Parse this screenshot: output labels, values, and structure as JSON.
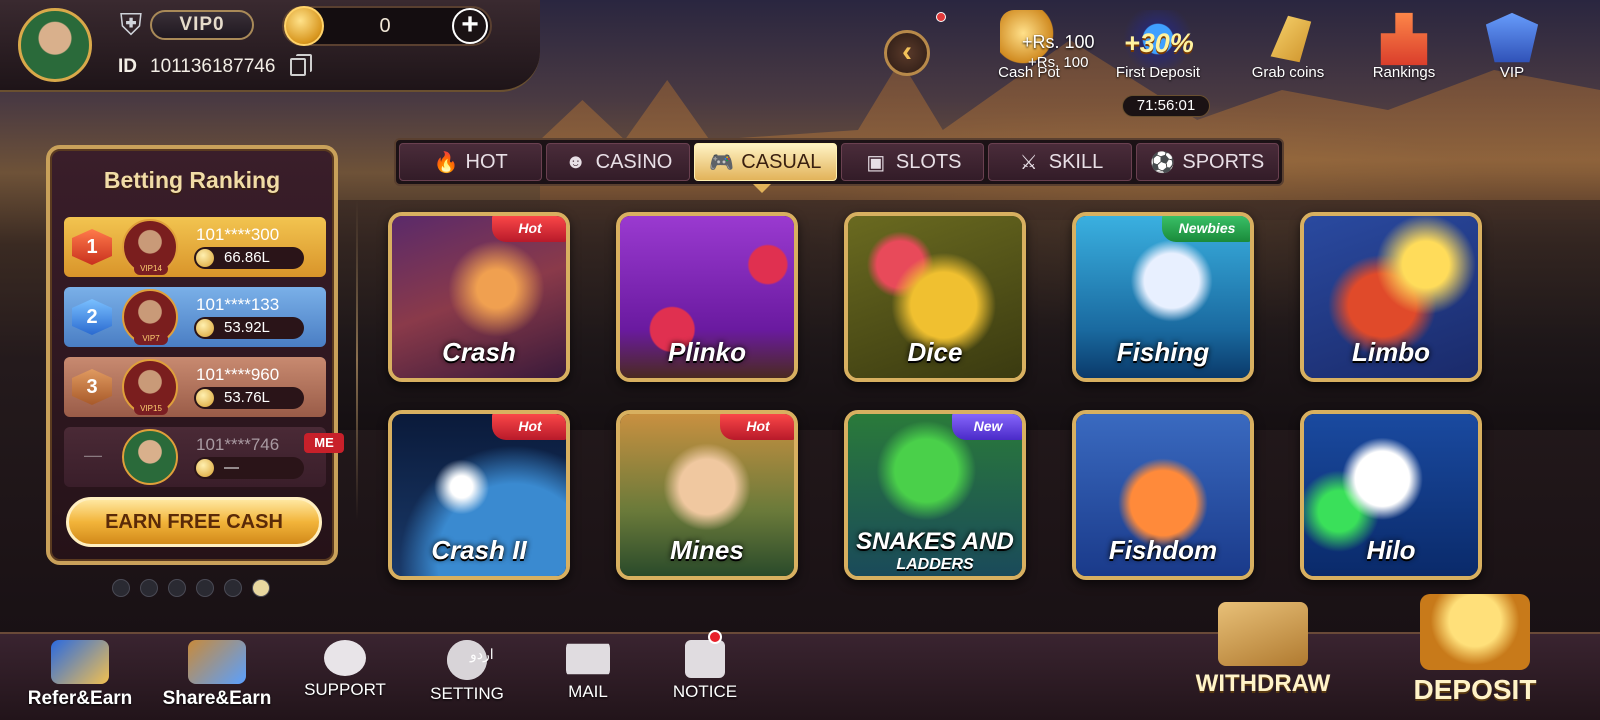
{
  "header": {
    "vip_level": "VIP0",
    "balance": "0",
    "plus_label": "+",
    "id_label": "ID",
    "user_id": "101136187746"
  },
  "top_actions": {
    "cash_pot": {
      "label": "Cash Pot",
      "amount_primary": "+Rs. 100",
      "amount_secondary": "+Rs. 100"
    },
    "first_deposit": {
      "label": "First Deposit",
      "percent": "+30%",
      "timer": "71:56:01"
    },
    "grab_coins": {
      "label": "Grab coins"
    },
    "rankings": {
      "label": "Rankings"
    },
    "vip": {
      "label": "VIP"
    }
  },
  "tabs": [
    {
      "label": "HOT",
      "icon": "flame-icon"
    },
    {
      "label": "CASINO",
      "icon": "dealer-icon"
    },
    {
      "label": "CASUAL",
      "icon": "gamepad-icon",
      "active": true
    },
    {
      "label": "SLOTS",
      "icon": "slot-machine-icon"
    },
    {
      "label": "SKILL",
      "icon": "swords-icon"
    },
    {
      "label": "SPORTS",
      "icon": "soccer-ball-icon"
    }
  ],
  "ranking": {
    "title": "Betting Ranking",
    "rows": [
      {
        "rank": "1",
        "vip": "VIP14",
        "user": "101****300",
        "amount": "66.86L"
      },
      {
        "rank": "2",
        "vip": "VIP7",
        "user": "101****133",
        "amount": "53.92L"
      },
      {
        "rank": "3",
        "vip": "VIP15",
        "user": "101****960",
        "amount": "53.76L"
      },
      {
        "rank": "—",
        "user": "101****746",
        "amount": "—",
        "me": "ME"
      }
    ],
    "earn_button": "EARN FREE CASH"
  },
  "games": [
    {
      "name": "Crash",
      "tag": "Hot"
    },
    {
      "name": "Plinko"
    },
    {
      "name": "Dice"
    },
    {
      "name": "Fishing",
      "tag": "Newbies"
    },
    {
      "name": "Limbo"
    },
    {
      "name": "Crash II",
      "tag": "Hot"
    },
    {
      "name": "Mines",
      "tag": "Hot"
    },
    {
      "name": "SNAKES AND",
      "name_line2": "LADDERS",
      "tag": "New"
    },
    {
      "name": "Fishdom"
    },
    {
      "name": "Hilo"
    }
  ],
  "bottom_nav": {
    "refer": "Refer&Earn",
    "share": "Share&Earn",
    "support": "SUPPORT",
    "setting": "SETTING",
    "setting_glyph": "اردو",
    "mail": "MAIL",
    "notice": "NOTICE",
    "withdraw": "WITHDRAW",
    "deposit": "DEPOSIT"
  },
  "colors": {
    "gold_accent": "#d8b060",
    "tab_active": "#e2b35a",
    "hot_tag": "#d8202a",
    "newbies_tag": "#1a8a3a",
    "new_tag": "#4a2ac8"
  }
}
